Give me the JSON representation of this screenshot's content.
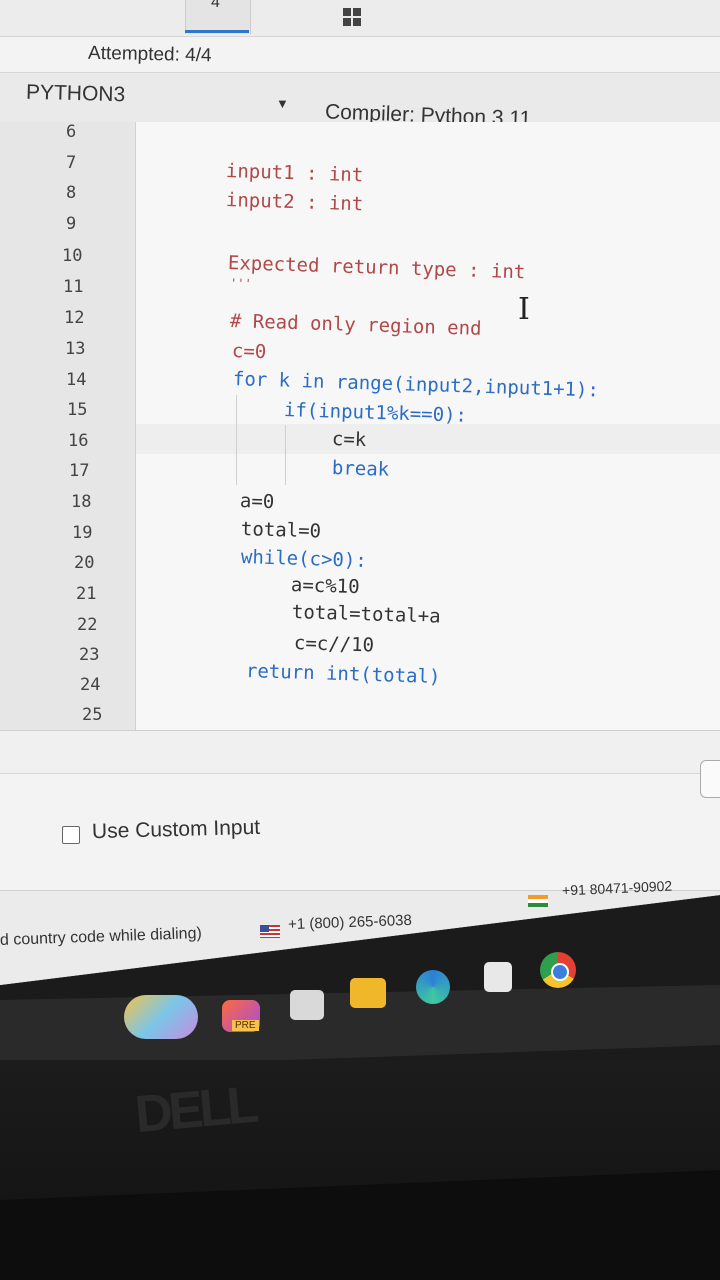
{
  "header": {
    "attempted": "Attempted: 4/4",
    "tab_count": "4"
  },
  "toolbar": {
    "language": "PYTHON3",
    "compiler": "Compiler: Python 3.11"
  },
  "editor": {
    "line_numbers": [
      "6",
      "7",
      "8",
      "9",
      "10",
      "11",
      "12",
      "13",
      "14",
      "15",
      "16",
      "17",
      "18",
      "19",
      "20",
      "21",
      "22",
      "23",
      "24",
      "25"
    ],
    "lines": [
      {
        "text": "input1 : int",
        "style": "ro"
      },
      {
        "text": "input2 : int",
        "style": "ro"
      },
      {
        "text": "Expected return type : int",
        "style": "ro"
      },
      {
        "text": "'''",
        "style": "ro"
      },
      {
        "text": "# Read only region end",
        "style": "ro"
      },
      {
        "text": "c=0",
        "style": "txt"
      },
      {
        "text": "for k in range(input2,input1+1):",
        "style": "kw"
      },
      {
        "text": "if(input1%k==0):",
        "style": "kw"
      },
      {
        "text": "c=k",
        "style": "txt"
      },
      {
        "text": "break",
        "style": "kw"
      },
      {
        "text": "a=0",
        "style": "txt"
      },
      {
        "text": "total=0",
        "style": "txt"
      },
      {
        "text": "while(c>0):",
        "style": "kw"
      },
      {
        "text": "a=c%10",
        "style": "txt"
      },
      {
        "text": "total=total+a",
        "style": "txt"
      },
      {
        "text": "c=c//10",
        "style": "txt"
      },
      {
        "text": "return int(total)",
        "style": "kw"
      }
    ]
  },
  "footer": {
    "custom_input_label": "Use Custom Input",
    "dial_note": "d country code while dialing)",
    "us_phone": "+1 (800) 265-6038",
    "in_phone": "+91 80471-90902"
  },
  "taskbar": {
    "premiere_label": "PRE"
  },
  "bezel": {
    "brand": "DELL"
  },
  "colors": {
    "read_only_text": "#b04848",
    "keyword_blue": "#2b6cc4",
    "accent": "#2f77c8"
  },
  "icons": [
    "windows-icon",
    "text-cursor-icon",
    "checkbox-icon",
    "us-flag-icon",
    "india-flag-icon",
    "photos-icon",
    "premiere-icon",
    "files-icon",
    "folder-icon",
    "edge-icon",
    "store-icon",
    "chrome-icon"
  ]
}
